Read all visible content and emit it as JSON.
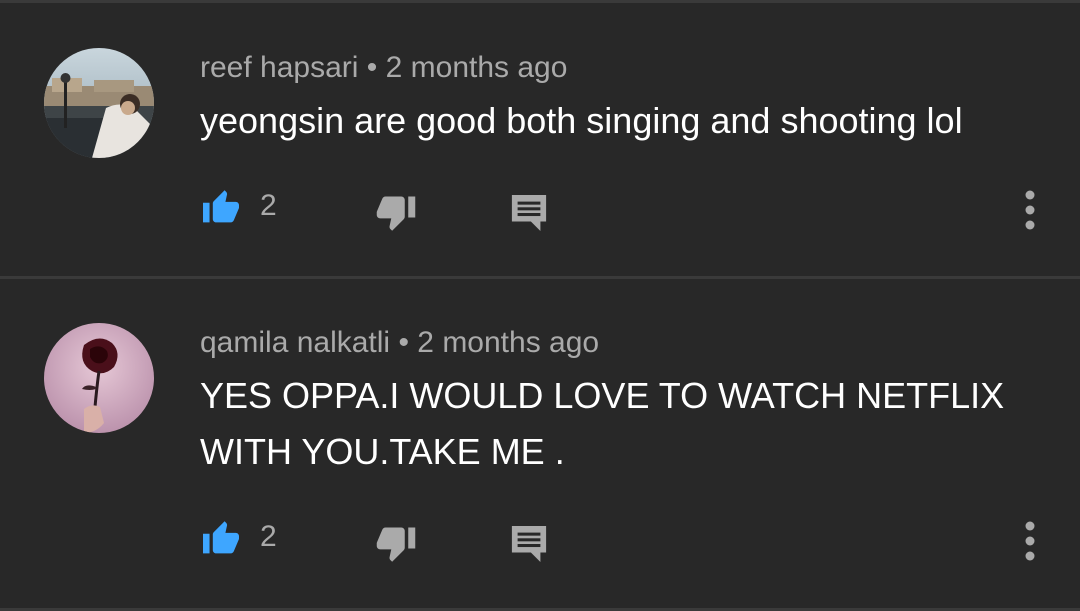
{
  "comments": [
    {
      "author": "reef hapsari",
      "separator": "•",
      "time": "2 months ago",
      "text": "yeongsin are good both singing and shooting lol",
      "likes": "2",
      "icons": [
        "thumbs-up-icon",
        "thumbs-down-icon",
        "reply-icon",
        "more-vert-icon"
      ]
    },
    {
      "author": "qamila nalkatli",
      "separator": "•",
      "time": "2 months ago",
      "text": "YES OPPA.I WOULD LOVE TO WATCH NETFLIX\nWITH YOU.TAKE ME .",
      "likes": "2",
      "icons": [
        "thumbs-up-icon",
        "thumbs-down-icon",
        "reply-icon",
        "more-vert-icon"
      ]
    }
  ],
  "colors": {
    "background": "#282828",
    "like_active": "#3ea6ff",
    "icon_gray": "#aaaaaa",
    "text": "#ffffff"
  }
}
